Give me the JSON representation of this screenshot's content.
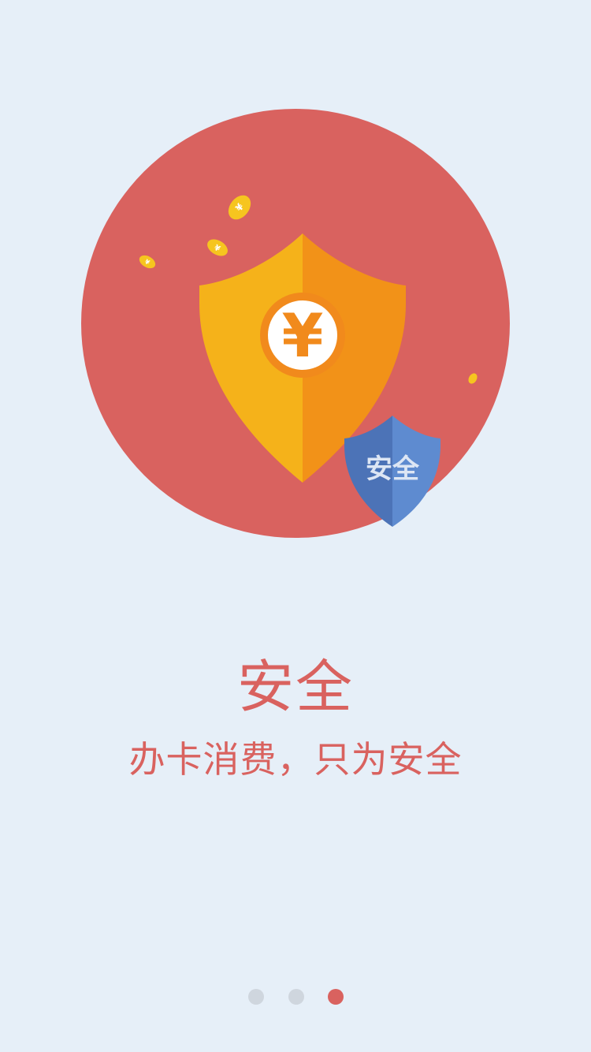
{
  "intro": {
    "badge_text": "安全",
    "currency_symbol": "¥",
    "title": "安全",
    "subtitle": "办卡消费，只为安全"
  },
  "pager": {
    "total": 3,
    "active_index": 2,
    "active_color": "#d9625f",
    "inactive_color": "#cfd6de"
  },
  "colors": {
    "background": "#e6eff8",
    "circle": "#d9625f",
    "shield_left": "#f5b21a",
    "shield_right": "#f29218",
    "blue_shield_left": "#4c73b7",
    "blue_shield_right": "#5e8bd0",
    "coin": "#f6c51f"
  }
}
